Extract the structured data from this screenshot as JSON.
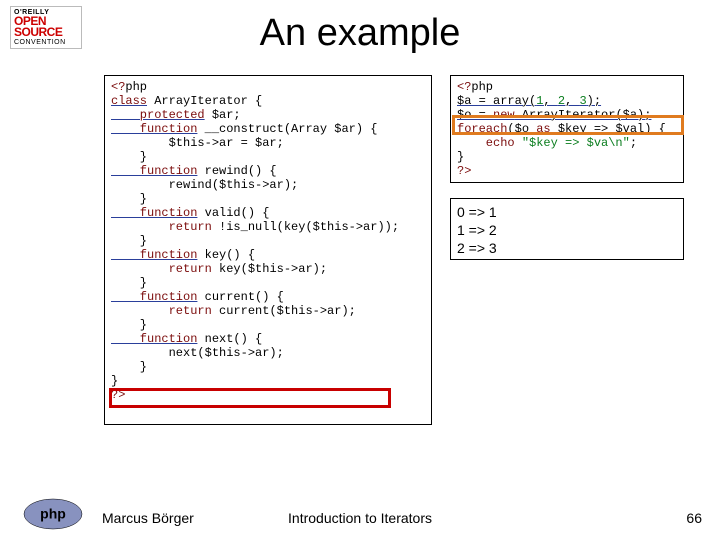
{
  "logo": {
    "oreilly": "O'REILLY",
    "open": "OPEN",
    "source": "SOURCE",
    "convention": "CONVENTION"
  },
  "title": "An example",
  "code_left": {
    "l1a": "<?",
    "l1b": "php",
    "l2a": "class",
    "l2b": " ArrayIterator {",
    "l3a": "    protected",
    "l3b": " $ar;",
    "l4a": "    function",
    "l4b": " __construct(Array $ar) {",
    "l5": "        $this->ar = $ar;",
    "l6": "    }",
    "l7a": "    function",
    "l7b": " rewind() {",
    "l8": "        rewind($this->ar);",
    "l9": "    }",
    "l10a": "    function",
    "l10b": " valid() {",
    "l11a": "        return",
    "l11b": " !is_null(key($this->ar));",
    "l12": "    }",
    "l13a": "    function",
    "l13b": " key() {",
    "l14a": "        return",
    "l14b": " key($this->ar);",
    "l15": "    }",
    "l16a": "    function",
    "l16b": " current() {",
    "l17a": "        return",
    "l17b": " current($this->ar);",
    "l18": "    }",
    "l19a": "    function",
    "l19b": " next() {",
    "l20": "        next($this->ar);",
    "l21": "    }",
    "l22": "}",
    "l23": "?>"
  },
  "code_right": {
    "l1a": "<?",
    "l1b": "php",
    "l2a": "$a = array(",
    "l2n1": "1",
    "l2c": ", ",
    "l2n2": "2",
    "l2d": ", ",
    "l2n3": "3",
    "l2e": ");",
    "l3a": "$o = ",
    "l3b": "new",
    "l3c": " ArrayIterator($a);",
    "l4a": "foreach",
    "l4b": "($o ",
    "l4c": "as",
    "l4d": " $key => $val) {",
    "l5a": "    echo",
    "l5b": " ",
    "l5c": "\"$key => $va\\n\"",
    "l5d": ";",
    "l6": "}",
    "l7": "?>"
  },
  "output": {
    "l1": "0 => 1",
    "l2": "1 => 2",
    "l3": "2 => 3"
  },
  "footer": {
    "author": "Marcus Börger",
    "title": "Introduction to Iterators",
    "page": "66"
  },
  "icons": {
    "php": "php"
  }
}
